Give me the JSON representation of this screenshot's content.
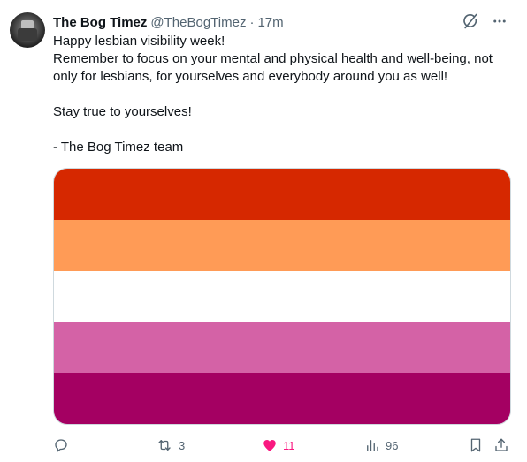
{
  "post": {
    "author_name": "The Bog Timez",
    "handle": "@TheBogTimez",
    "separator": "·",
    "time": "17m",
    "lines": [
      "Happy lesbian visibility week!",
      "Remember to focus on your mental and physical health and well-being, not",
      "only for lesbians, for yourselves and everybody around you as well!",
      "",
      "Stay true to yourselves!",
      "",
      "- The Bog Timez team"
    ]
  },
  "media": {
    "flag_colors": [
      "#d62800",
      "#ff9b56",
      "#ffffff",
      "#d462a6",
      "#a40062"
    ]
  },
  "actions": {
    "reply_count": "",
    "repost_count": "3",
    "like_count": "11",
    "views_count": "96"
  },
  "icons": {
    "header_left": "grok-icon",
    "header_right": "more-icon",
    "reply": "reply-icon",
    "repost": "repost-icon",
    "like": "heart-icon",
    "views": "views-icon",
    "bookmark": "bookmark-icon",
    "share": "share-icon"
  },
  "colors": {
    "text_primary": "#0f1419",
    "text_secondary": "#536471",
    "like_accent": "#f91880",
    "border": "#cfd9de"
  }
}
